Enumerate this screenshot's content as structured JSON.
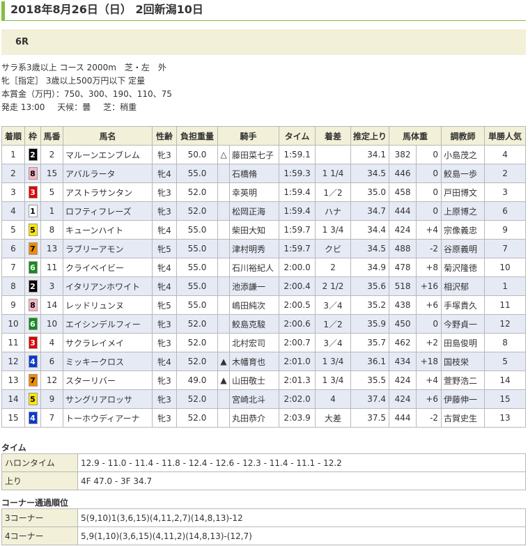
{
  "title": "2018年8月26日（日） 2回新潟10日",
  "race": "6R",
  "info": {
    "line1": "サラ系3歳以上 コース 2000m　芝・左　外",
    "line2": "牝［指定］ 3歳以上500万円以下 定量",
    "line3": "本賞金（万円）：750、300、190、110、75",
    "start": "発走 13:00",
    "weather": "天候：曇",
    "track": "芝：稍重"
  },
  "headers": [
    "着順",
    "枠",
    "馬番",
    "馬名",
    "性齢",
    "負担重量",
    "騎手",
    "タイム",
    "着差",
    "推定上り",
    "馬体重",
    "",
    "調教師",
    "単勝人気"
  ],
  "rows": [
    {
      "pos": "1",
      "waku": "2",
      "num": "2",
      "name": "マルーンエンブレム",
      "sex": "牝3",
      "wt": "50.0",
      "mark": "△",
      "jockey": "藤田菜七子",
      "time": "1:59.1",
      "margin": "",
      "last": "34.1",
      "bw": "382",
      "diff": "0",
      "trainer": "小島茂之",
      "pop": "4"
    },
    {
      "pos": "2",
      "waku": "8",
      "num": "15",
      "name": "アバルラータ",
      "sex": "牝4",
      "wt": "55.0",
      "mark": "",
      "jockey": "石橋脩",
      "time": "1:59.3",
      "margin": "1 1/4",
      "last": "34.5",
      "bw": "446",
      "diff": "0",
      "trainer": "鮫島一歩",
      "pop": "2"
    },
    {
      "pos": "3",
      "waku": "3",
      "num": "5",
      "name": "アストラサンタン",
      "sex": "牝3",
      "wt": "52.0",
      "mark": "",
      "jockey": "幸英明",
      "time": "1:59.4",
      "margin": "1／2",
      "last": "35.0",
      "bw": "458",
      "diff": "0",
      "trainer": "戸田博文",
      "pop": "3"
    },
    {
      "pos": "4",
      "waku": "1",
      "num": "1",
      "name": "ロフティフレーズ",
      "sex": "牝3",
      "wt": "52.0",
      "mark": "",
      "jockey": "松岡正海",
      "time": "1:59.4",
      "margin": "ハナ",
      "last": "34.7",
      "bw": "444",
      "diff": "0",
      "trainer": "上原博之",
      "pop": "6"
    },
    {
      "pos": "5",
      "waku": "5",
      "num": "8",
      "name": "キューンハイト",
      "sex": "牝4",
      "wt": "55.0",
      "mark": "",
      "jockey": "柴田大知",
      "time": "1:59.7",
      "margin": "1 3/4",
      "last": "34.4",
      "bw": "424",
      "diff": "+4",
      "trainer": "宗像義忠",
      "pop": "9"
    },
    {
      "pos": "6",
      "waku": "7",
      "num": "13",
      "name": "ラブリーアモン",
      "sex": "牝5",
      "wt": "55.0",
      "mark": "",
      "jockey": "津村明秀",
      "time": "1:59.7",
      "margin": "クビ",
      "last": "34.5",
      "bw": "488",
      "diff": "-2",
      "trainer": "谷原義明",
      "pop": "7"
    },
    {
      "pos": "7",
      "waku": "6",
      "num": "11",
      "name": "クライベイビー",
      "sex": "牝4",
      "wt": "55.0",
      "mark": "",
      "jockey": "石川裕紀人",
      "time": "2:00.0",
      "margin": "2",
      "last": "34.9",
      "bw": "478",
      "diff": "+8",
      "trainer": "菊沢隆徳",
      "pop": "10"
    },
    {
      "pos": "8",
      "waku": "2",
      "num": "3",
      "name": "イタリアンホワイト",
      "sex": "牝4",
      "wt": "55.0",
      "mark": "",
      "jockey": "池添謙一",
      "time": "2:00.4",
      "margin": "2 1/2",
      "last": "35.6",
      "bw": "518",
      "diff": "+16",
      "trainer": "相沢郁",
      "pop": "1"
    },
    {
      "pos": "9",
      "waku": "8",
      "num": "14",
      "name": "レッドリュンヌ",
      "sex": "牝5",
      "wt": "55.0",
      "mark": "",
      "jockey": "嶋田純次",
      "time": "2:00.5",
      "margin": "3／4",
      "last": "35.2",
      "bw": "438",
      "diff": "+6",
      "trainer": "手塚貴久",
      "pop": "11"
    },
    {
      "pos": "10",
      "waku": "6",
      "num": "10",
      "name": "エイシンデルフィー",
      "sex": "牝3",
      "wt": "52.0",
      "mark": "",
      "jockey": "鮫島克駿",
      "time": "2:00.6",
      "margin": "1／2",
      "last": "35.9",
      "bw": "450",
      "diff": "0",
      "trainer": "今野貞一",
      "pop": "12"
    },
    {
      "pos": "11",
      "waku": "3",
      "num": "4",
      "name": "サクラレイメイ",
      "sex": "牝3",
      "wt": "52.0",
      "mark": "",
      "jockey": "北村宏司",
      "time": "2:00.7",
      "margin": "3／4",
      "last": "35.7",
      "bw": "462",
      "diff": "+2",
      "trainer": "田島俊明",
      "pop": "8"
    },
    {
      "pos": "12",
      "waku": "4",
      "num": "6",
      "name": "ミッキークロス",
      "sex": "牝4",
      "wt": "52.0",
      "mark": "▲",
      "jockey": "木幡育也",
      "time": "2:01.0",
      "margin": "1 3/4",
      "last": "36.1",
      "bw": "434",
      "diff": "+18",
      "trainer": "国枝栄",
      "pop": "5"
    },
    {
      "pos": "13",
      "waku": "7",
      "num": "12",
      "name": "スターリバー",
      "sex": "牝3",
      "wt": "49.0",
      "mark": "▲",
      "jockey": "山田敬士",
      "time": "2:01.3",
      "margin": "1 3/4",
      "last": "35.5",
      "bw": "424",
      "diff": "+4",
      "trainer": "萱野浩二",
      "pop": "14"
    },
    {
      "pos": "14",
      "waku": "5",
      "num": "9",
      "name": "サングリアロッサ",
      "sex": "牝3",
      "wt": "52.0",
      "mark": "",
      "jockey": "宮崎北斗",
      "time": "2:02.0",
      "margin": "4",
      "last": "37.4",
      "bw": "424",
      "diff": "+6",
      "trainer": "伊藤伸一",
      "pop": "15"
    },
    {
      "pos": "15",
      "waku": "4",
      "num": "7",
      "name": "トーホウディアーナ",
      "sex": "牝3",
      "wt": "52.0",
      "mark": "",
      "jockey": "丸田恭介",
      "time": "2:03.9",
      "margin": "大差",
      "last": "37.5",
      "bw": "444",
      "diff": "-2",
      "trainer": "古賀史生",
      "pop": "13"
    }
  ],
  "time_section": {
    "title": "タイム",
    "rows": [
      {
        "label": "ハロンタイム",
        "value": "12.9 - 11.0 - 11.4 - 11.8 - 12.4 - 12.6 - 12.3 - 11.4 - 11.1 - 12.2"
      },
      {
        "label": "上り",
        "value": "4F 47.0 - 3F 34.7"
      }
    ]
  },
  "corner_section": {
    "title": "コーナー通過順位",
    "rows": [
      {
        "label": "3コーナー",
        "value": "5(9,10)1(3,6,15)(4,11,2,7)(14,8,13)-12"
      },
      {
        "label": "4コーナー",
        "value": "5,9(1,10)(3,6,15)(4,11,2)(14,8,13)-(12,7)"
      }
    ]
  }
}
